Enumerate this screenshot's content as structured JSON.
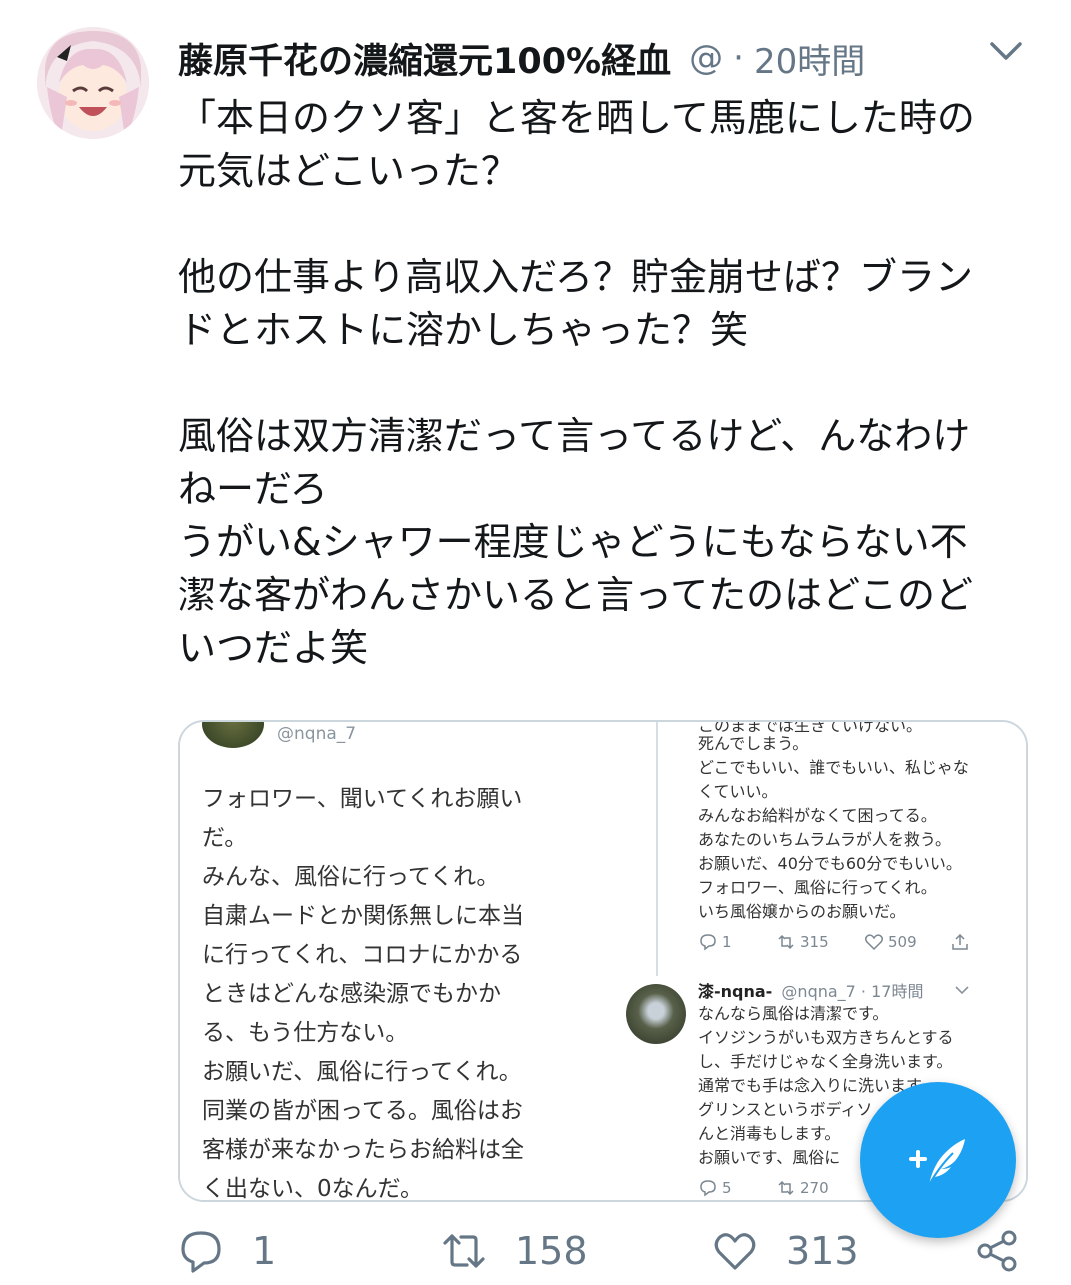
{
  "tweet": {
    "display_name": "藤原千花の濃縮還元100%経血",
    "handle": "@",
    "separator": "·",
    "time": "20時間",
    "text_lines": [
      "「本日のクソ客」と客を晒して馬鹿にした時の",
      "元気はどこいった？",
      "",
      "他の仕事より高収入だろ？貯金崩せば？ブラン",
      "ドとホストに溶かしちゃった？笑",
      "",
      "風俗は双方清潔だって言ってるけど、んなわけ",
      "ねーだろ",
      "うがい&シャワー程度じゃどうにもならない不",
      "潔な客がわんさかいると言ってたのはどこのど",
      "いつだよ笑"
    ],
    "actions": {
      "reply_count": "1",
      "retweet_count": "158",
      "like_count": "313"
    }
  },
  "embedded_left": {
    "handle": "@nqna_7",
    "lines": [
      "フォロワー、聞いてくれお願い",
      "だ。",
      "みんな、風俗に行ってくれ。",
      "自粛ムードとか関係無しに本当",
      "に行ってくれ、コロナにかかる",
      "ときはどんな感染源でもかか",
      "る、もう仕方ない。",
      "お願いだ、風俗に行ってくれ。",
      "同業の皆が困ってる。風俗はお",
      "客様が来なかったらお給料は全",
      "く出ない、0なんだ。"
    ]
  },
  "embedded_right": {
    "cut_line": "このままでは生きていけない。",
    "lines1": [
      "死んでしまう。",
      "どこでもいい、誰でもいい、私じゃな",
      "くていい。",
      "みんなお給料がなくて困ってる。",
      "あなたのいちムラムラが人を救う。",
      "お願いだ、40分でも60分でもいい。",
      "フォロワー、風俗に行ってくれ。",
      "いち風俗嬢からのお願いだ。"
    ],
    "actions1": {
      "reply": "1",
      "retweet": "315",
      "like": "509"
    },
    "name": "漆-nqna-",
    "handle_time": "@nqna_7 · 17時間",
    "lines2": [
      "なんなら風俗は清潔です。",
      "イソジンうがいも双方きちんとする",
      "し、手だけじゃなく全身洗います。",
      "通常でも手は念入りに洗います",
      "グリンスというボディソ",
      "んと消毒もします。",
      "お願いです、風俗に"
    ],
    "actions2": {
      "reply": "5",
      "retweet": "270"
    }
  },
  "icons": {
    "caret": "chevron-down-icon",
    "compose": "compose-tweet-icon",
    "reply": "reply-icon",
    "retweet": "retweet-icon",
    "like": "heart-icon",
    "share": "share-icon"
  },
  "colors": {
    "accent": "#1da1f2",
    "text": "#14171a",
    "muted": "#657786",
    "border": "#ccd6dd"
  }
}
